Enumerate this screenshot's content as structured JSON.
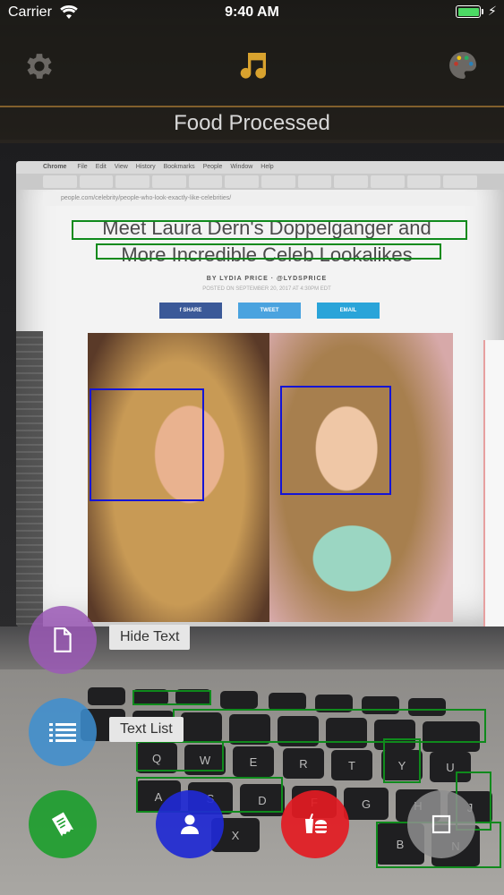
{
  "status_bar": {
    "carrier": "Carrier",
    "time": "9:40 AM"
  },
  "header": {
    "title": "Food Processed",
    "icons": {
      "left": "gear-icon",
      "center": "music-note-icon",
      "right": "palette-icon"
    },
    "accent_color": "#d8a22e"
  },
  "scene": {
    "article_title_line1": "Meet Laura Dern's Doppelganger and",
    "article_title_line2": "More Incredible Celeb Lookalikes",
    "byline": "BY LYDIA PRICE · @LYDSPRICE",
    "posted": "POSTED ON SEPTEMBER 20, 2017 AT 4:30PM EDT",
    "share_buttons": [
      "f SHARE",
      "TWEET",
      "EMAIL"
    ],
    "browser_app": "Chrome",
    "browser_menu": [
      "File",
      "Edit",
      "View",
      "History",
      "Bookmarks",
      "People",
      "Window",
      "Help"
    ],
    "url": "people.com/celebrity/people-who-look-exactly-like-celebrities/",
    "keys": [
      "Q",
      "W",
      "E",
      "R",
      "T",
      "Y",
      "U",
      "A",
      "S",
      "D",
      "F",
      "G",
      "H",
      "J",
      "X",
      "B",
      "N"
    ]
  },
  "controls": {
    "hide_text": {
      "label": "Hide Text",
      "icon": "document-icon",
      "color": "#9b59b6"
    },
    "text_list": {
      "label": "Text List",
      "icon": "list-icon",
      "color": "#3d8fd1"
    },
    "bottom_buttons": [
      {
        "name": "barcode-scan-button",
        "icon": "receipt-icon",
        "color": "#1e9e2f"
      },
      {
        "name": "face-detect-button",
        "icon": "person-icon",
        "color": "#1f29d4"
      },
      {
        "name": "food-detect-button",
        "icon": "drink-burger-icon",
        "color": "#e31b23"
      },
      {
        "name": "object-detect-button",
        "icon": "square-icon",
        "color": "#8f8f8f"
      }
    ]
  },
  "detections": {
    "text_box_color": "#0f8a1c",
    "face_box_color": "#1414d6"
  }
}
